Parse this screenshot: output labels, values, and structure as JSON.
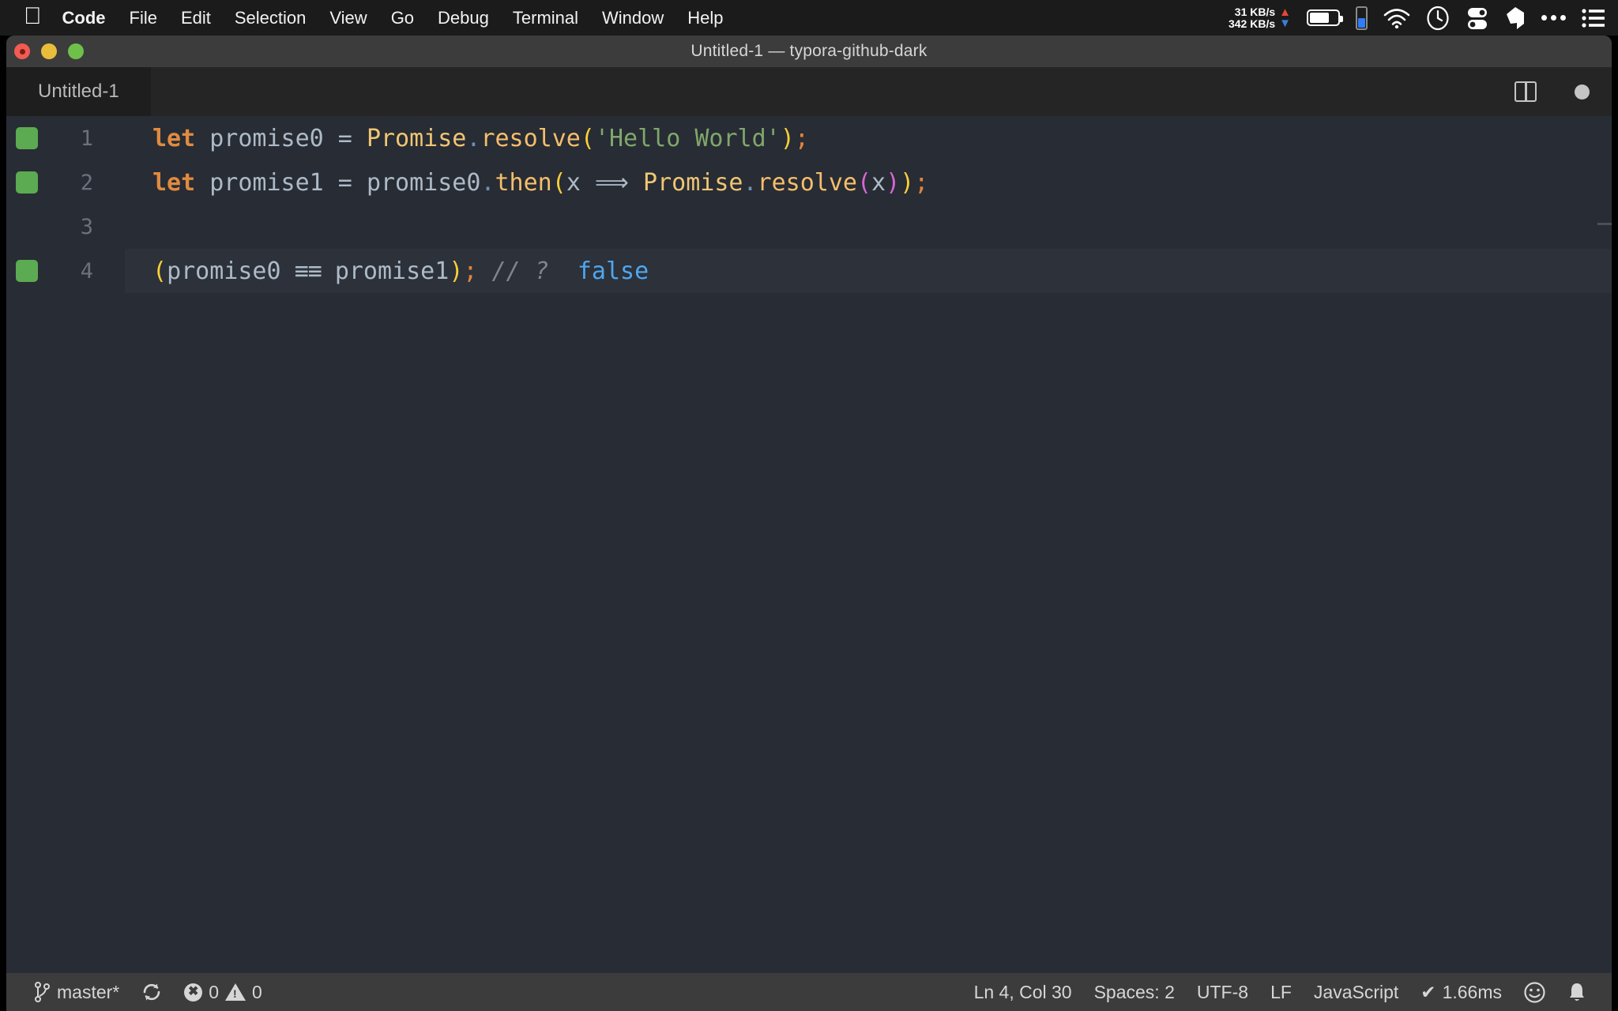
{
  "menubar": {
    "apple_icon": "apple-logo-icon",
    "items": [
      {
        "label": "Code",
        "bold": true
      },
      {
        "label": "File",
        "bold": false
      },
      {
        "label": "Edit",
        "bold": false
      },
      {
        "label": "Selection",
        "bold": false
      },
      {
        "label": "View",
        "bold": false
      },
      {
        "label": "Go",
        "bold": false
      },
      {
        "label": "Debug",
        "bold": false
      },
      {
        "label": "Terminal",
        "bold": false
      },
      {
        "label": "Window",
        "bold": false
      },
      {
        "label": "Help",
        "bold": false
      }
    ],
    "network": {
      "upload": "31 KB/s",
      "download": "342 KB/s",
      "up_arrow": "▲",
      "down_arrow": "▼",
      "up_color": "#e8453c",
      "down_color": "#3b7ddd"
    },
    "status_icons": [
      "battery-icon",
      "phone-battery-icon",
      "wifi-icon",
      "clock-icon",
      "toggles-icon",
      "pencil-icon",
      "ellipsis-icon",
      "list-menu-icon"
    ]
  },
  "window": {
    "title": "Untitled-1 — typora-github-dark",
    "traffic_lights": [
      "close-button",
      "minimize-button",
      "maximize-button"
    ]
  },
  "tabbar": {
    "tabs": [
      {
        "label": "Untitled-1",
        "active": true
      }
    ],
    "actions": [
      "split-editor-icon",
      "more-actions-dot-icon"
    ]
  },
  "editor": {
    "language": "JavaScript",
    "lines": [
      {
        "number": "1",
        "marker": true,
        "highlight": false,
        "tokens": [
          {
            "t": "let",
            "c": "kw"
          },
          {
            "t": " ",
            "c": "op"
          },
          {
            "t": "promise0",
            "c": "var"
          },
          {
            "t": " = ",
            "c": "op"
          },
          {
            "t": "Promise",
            "c": "cls"
          },
          {
            "t": ".",
            "c": "dot"
          },
          {
            "t": "resolve",
            "c": "fn"
          },
          {
            "t": "(",
            "c": "paren-y"
          },
          {
            "t": "'Hello World'",
            "c": "str"
          },
          {
            "t": ")",
            "c": "paren-y"
          },
          {
            "t": ";",
            "c": "semi"
          }
        ]
      },
      {
        "number": "2",
        "marker": true,
        "highlight": false,
        "tokens": [
          {
            "t": "let",
            "c": "kw"
          },
          {
            "t": " ",
            "c": "op"
          },
          {
            "t": "promise1",
            "c": "var"
          },
          {
            "t": " = ",
            "c": "op"
          },
          {
            "t": "promise0",
            "c": "var"
          },
          {
            "t": ".",
            "c": "dot"
          },
          {
            "t": "then",
            "c": "fn"
          },
          {
            "t": "(",
            "c": "paren-y"
          },
          {
            "t": "x",
            "c": "var"
          },
          {
            "t": " ⟹ ",
            "c": "op"
          },
          {
            "t": "Promise",
            "c": "cls"
          },
          {
            "t": ".",
            "c": "dot"
          },
          {
            "t": "resolve",
            "c": "fn"
          },
          {
            "t": "(",
            "c": "paren-m"
          },
          {
            "t": "x",
            "c": "var"
          },
          {
            "t": ")",
            "c": "paren-m"
          },
          {
            "t": ")",
            "c": "paren-y"
          },
          {
            "t": ";",
            "c": "semi"
          }
        ]
      },
      {
        "number": "3",
        "marker": false,
        "highlight": false,
        "tokens": []
      },
      {
        "number": "4",
        "marker": true,
        "highlight": true,
        "tokens": [
          {
            "t": "(",
            "c": "paren-y"
          },
          {
            "t": "promise0",
            "c": "var"
          },
          {
            "t": " ≡≡ ",
            "c": "op lig"
          },
          {
            "t": "promise1",
            "c": "var"
          },
          {
            "t": ")",
            "c": "paren-y"
          },
          {
            "t": ";",
            "c": "semi"
          },
          {
            "t": " // ?",
            "c": "cmt"
          },
          {
            "t": "  ",
            "c": "op"
          },
          {
            "t": "false",
            "c": "bool"
          }
        ]
      }
    ],
    "raw_text": "let promise0 = Promise.resolve('Hello World');\nlet promise1 = promise0.then(x => Promise.resolve(x));\n\n(promise0 === promise1); // ?  false"
  },
  "statusbar": {
    "branch": "master*",
    "branch_icon": "source-control-branch-icon",
    "sync_icon": "sync-icon",
    "errors": "0",
    "warnings": "0",
    "error_icon": "error-circle-icon",
    "warning_icon": "warning-triangle-icon",
    "cursor_position": "Ln 4, Col 30",
    "indentation": "Spaces: 2",
    "encoding": "UTF-8",
    "eol": "LF",
    "language_mode": "JavaScript",
    "quokka_check": "✔",
    "quokka_time": "1.66ms",
    "feedback_icon": "smiley-icon",
    "notifications_icon": "bell-icon"
  },
  "colors": {
    "menubar_bg": "#1b1b1b",
    "titlebar_bg": "#3c3c3c",
    "tabbar_bg": "#252526",
    "tab_active_bg": "#1e1e1e",
    "editor_bg": "#282c34",
    "statusbar_bg": "#3c3c3c",
    "marker_green": "#5caa52",
    "keyword_orange": "#e08b40",
    "string_green": "#7fa86c",
    "class_yellow": "#f0c674",
    "bool_blue": "#4fa6f0"
  }
}
